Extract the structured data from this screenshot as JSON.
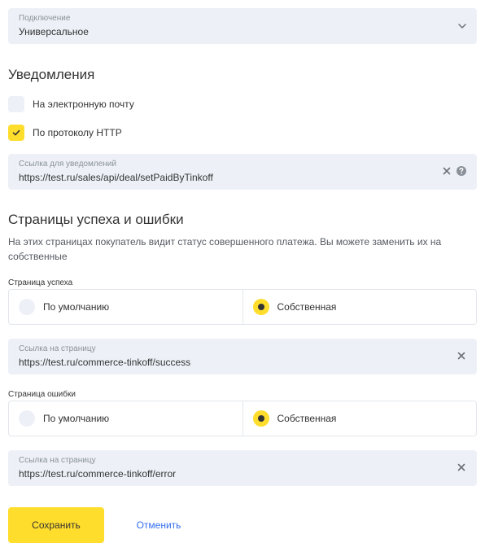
{
  "connection": {
    "label": "Подключение",
    "value": "Универсальное"
  },
  "notifications": {
    "title": "Уведомления",
    "email": {
      "label": "На электронную почту",
      "checked": false
    },
    "http": {
      "label": "По протоколу HTTP",
      "checked": true
    },
    "url_field": {
      "label": "Ссылка для уведомлений",
      "value": "https://test.ru/sales/api/deal/setPaidByTinkoff"
    }
  },
  "pages": {
    "title": "Страницы успеха и ошибки",
    "description": "На этих страницах покупатель видит статус совершенного платежа. Вы можете заменить их на собственные",
    "success": {
      "label": "Страница успеха",
      "options": [
        "По умолчанию",
        "Собственная"
      ],
      "selected": "Собственная",
      "url_label": "Ссылка на страницу",
      "url_value": "https://test.ru/commerce-tinkoff/success"
    },
    "error": {
      "label": "Страница ошибки",
      "options": [
        "По умолчанию",
        "Собственная"
      ],
      "selected": "Собственная",
      "url_label": "Ссылка на страницу",
      "url_value": "https://test.ru/commerce-tinkoff/error"
    }
  },
  "actions": {
    "save": "Сохранить",
    "cancel": "Отменить"
  },
  "colors": {
    "accent": "#ffdd2d",
    "field_bg": "#edf1f7",
    "link": "#336fee"
  },
  "icons": {
    "select": "chevron-down-icon",
    "clear": "close-icon",
    "help": "help-icon",
    "check": "checkmark-icon"
  }
}
